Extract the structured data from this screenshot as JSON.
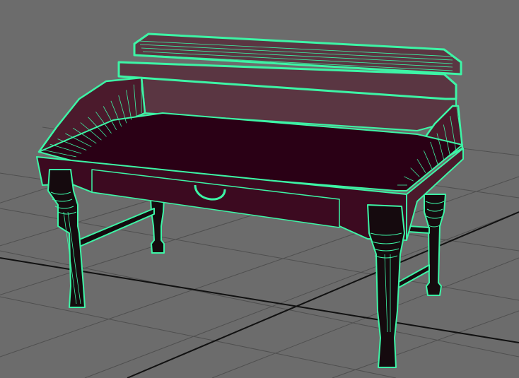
{
  "viewport": {
    "background_color": "#6c6c6c",
    "grid_color": "#4f4f4f",
    "grid_axis_color": "#111111",
    "wireframe_color": "#3df5a6",
    "wireframe_dark_color": "#13361f",
    "surface_colors": {
      "desktop_top": "#2a0015",
      "drawer_apron": "#3c0a20",
      "back_panel": "#5a3642",
      "side_panels": "#4b1a2c",
      "legs": "#150a0e"
    },
    "objects": [
      {
        "name": "writing-desk",
        "parts": [
          "top-gallery",
          "back-panel",
          "side-scroll-arm-left",
          "side-scroll-arm-right",
          "desktop-surface",
          "drawer-apron",
          "drawer-handle",
          "turned-legs",
          "stretchers"
        ]
      }
    ]
  }
}
